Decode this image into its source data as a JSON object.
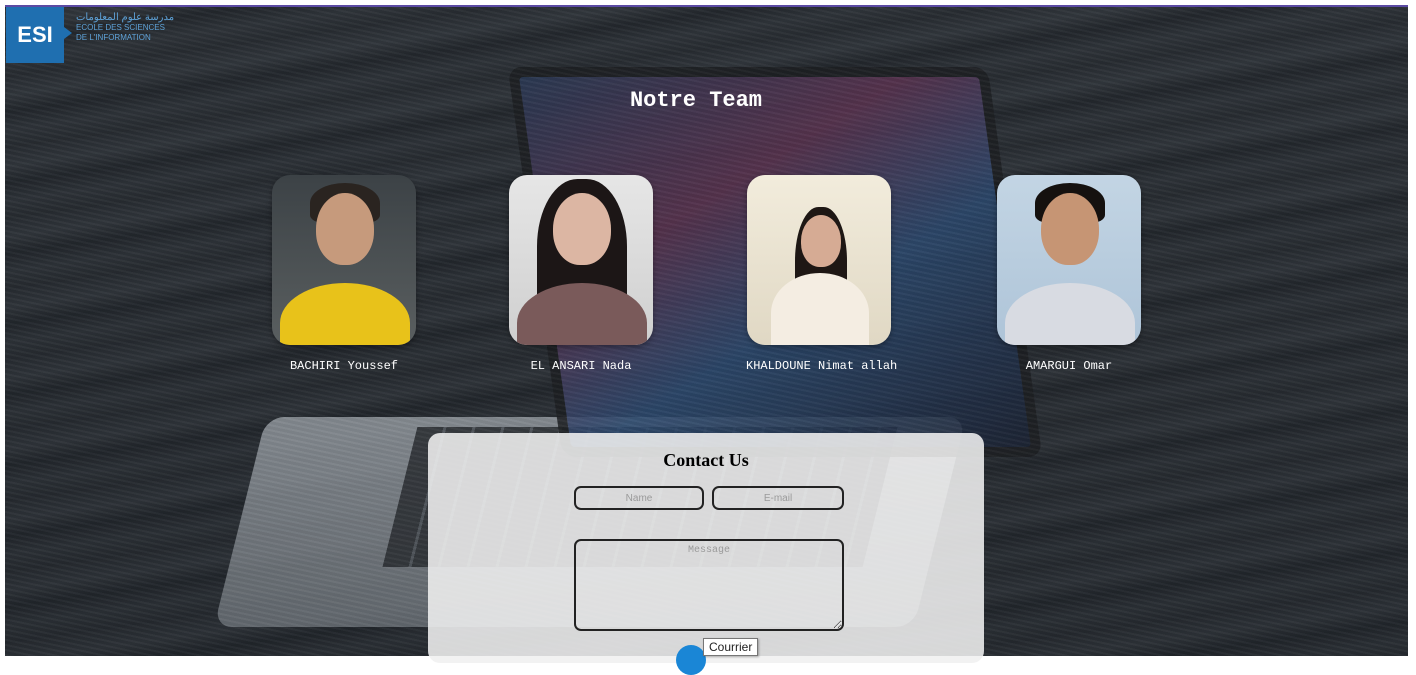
{
  "logo": {
    "abbr": "ESI",
    "arabic": "مدرسة علوم المعلومات",
    "line2": "ECOLE DES SCIENCES",
    "line3": "DE L'INFORMATION"
  },
  "page_title": "Notre Team",
  "team": [
    {
      "name": "BACHIRI Youssef"
    },
    {
      "name": "EL ANSARI Nada"
    },
    {
      "name": "KHALDOUNE Nimat allah"
    },
    {
      "name": "AMARGUI Omar"
    }
  ],
  "contact": {
    "title": "Contact Us",
    "name_placeholder": "Name",
    "email_placeholder": "E-mail",
    "message_placeholder": "Message"
  },
  "tooltip": "Courrier",
  "colors": {
    "accent": "#1f6fb0",
    "send_button": "#1a86d6"
  }
}
